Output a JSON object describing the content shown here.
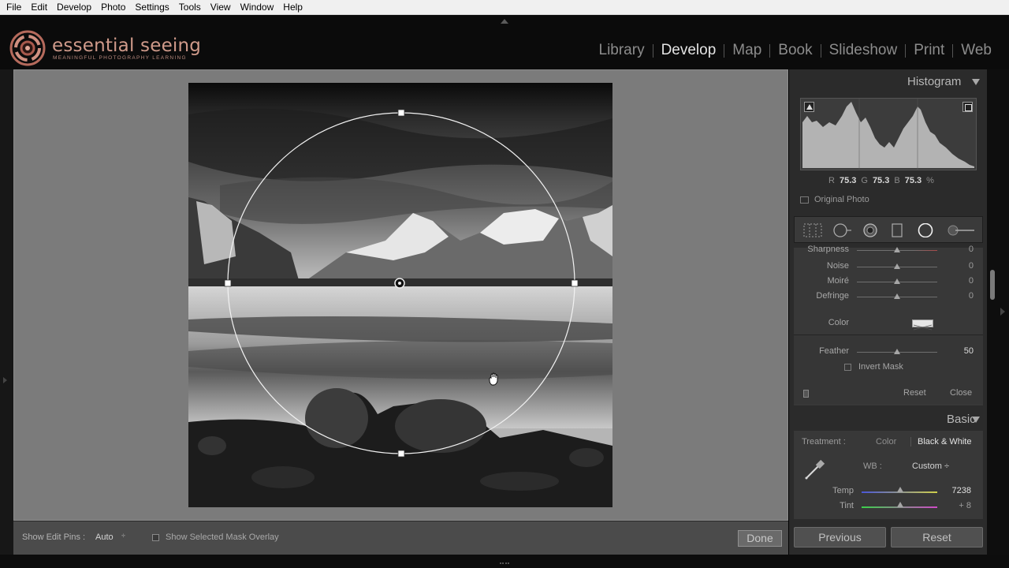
{
  "menu": [
    "File",
    "Edit",
    "Develop",
    "Photo",
    "Settings",
    "Tools",
    "View",
    "Window",
    "Help"
  ],
  "brand": {
    "name": "essential seeing",
    "tagline": "MEANINGFUL PHOTOGRAPHY LEARNING",
    "color": "#cf9a8a"
  },
  "modules": [
    {
      "label": "Library",
      "active": false
    },
    {
      "label": "Develop",
      "active": true
    },
    {
      "label": "Map",
      "active": false
    },
    {
      "label": "Book",
      "active": false
    },
    {
      "label": "Slideshow",
      "active": false
    },
    {
      "label": "Print",
      "active": false
    },
    {
      "label": "Web",
      "active": false
    }
  ],
  "histogram": {
    "title": "Histogram",
    "r_label": "R",
    "r_value": "75.3",
    "g_label": "G",
    "g_value": "75.3",
    "b_label": "B",
    "b_value": "75.3",
    "unit": "%",
    "original_photo_label": "Original Photo"
  },
  "tools": [
    "crop-overlay-icon",
    "spot-removal-icon",
    "red-eye-icon",
    "graduated-filter-icon",
    "radial-filter-icon",
    "adjustment-brush-icon"
  ],
  "radial_filter": {
    "sliders": [
      {
        "label": "Sharpness",
        "value": "0"
      },
      {
        "label": "Noise",
        "value": "0"
      },
      {
        "label": "Moiré",
        "value": "0"
      },
      {
        "label": "Defringe",
        "value": "0"
      }
    ],
    "color_label": "Color",
    "feather_label": "Feather",
    "feather_value": "50",
    "invert_mask_label": "Invert Mask",
    "reset_label": "Reset",
    "close_label": "Close"
  },
  "basic": {
    "title": "Basic",
    "treatment_label": "Treatment :",
    "treatment_color": "Color",
    "treatment_bw": "Black & White",
    "wb_label": "WB :",
    "wb_value": "Custom ÷",
    "temp_label": "Temp",
    "temp_value": "7238",
    "tint_label": "Tint",
    "tint_value": "+ 8"
  },
  "buttons": {
    "previous": "Previous",
    "reset": "Reset"
  },
  "toolbar": {
    "show_edit_pins_label": "Show Edit Pins :",
    "show_edit_pins_value": "Auto",
    "stepper": "÷",
    "overlay_label": "Show Selected Mask Overlay",
    "done_label": "Done"
  }
}
